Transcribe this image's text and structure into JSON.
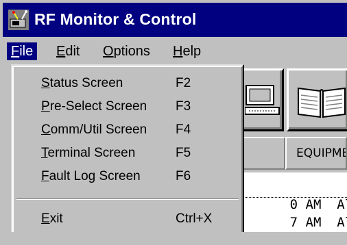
{
  "window": {
    "title": "RF Monitor & Control"
  },
  "menubar": {
    "items": [
      {
        "label": "File",
        "accel": "F"
      },
      {
        "label": "Edit",
        "accel": "E"
      },
      {
        "label": "Options",
        "accel": "O"
      },
      {
        "label": "Help",
        "accel": "H"
      }
    ]
  },
  "file_menu": {
    "items": [
      {
        "label": "Status Screen",
        "shortcut": "F2"
      },
      {
        "label": "Pre-Select Screen",
        "shortcut": "F3"
      },
      {
        "label": "Comm/Util Screen",
        "shortcut": "F4"
      },
      {
        "label": "Terminal Screen",
        "shortcut": "F5"
      },
      {
        "label": "Fault Log Screen",
        "shortcut": "F6"
      },
      {
        "label": "Exit",
        "shortcut": "Ctrl+X"
      }
    ]
  },
  "content": {
    "header_equipment": "EQUIPMENT",
    "log_rows": [
      {
        "time": "0 AM",
        "equip": "All"
      },
      {
        "time": "7 AM",
        "equip": "All"
      }
    ]
  },
  "icons": {
    "app": "rf-antenna-app-icon",
    "toolbar": [
      "computer-terminal-icon",
      "open-book-icon"
    ]
  },
  "colors": {
    "title_bar": "#000080",
    "menu_highlight": "#000080",
    "face": "#c0c0c0"
  }
}
